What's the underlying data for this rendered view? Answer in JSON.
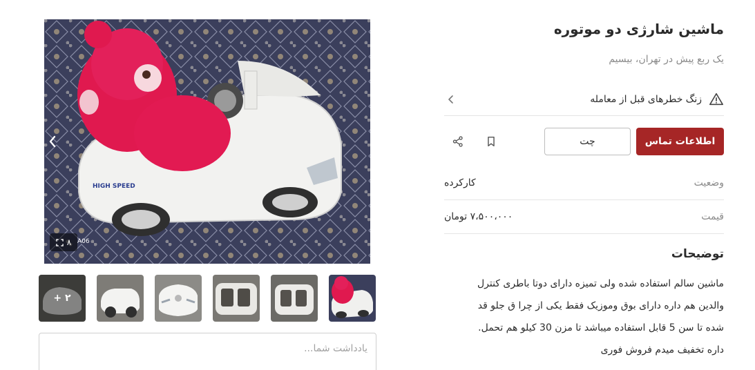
{
  "listing": {
    "title": "ماشین شارژی دو موتوره",
    "subtitle": "یک ربع پیش در تهران، بیسیم"
  },
  "warning": {
    "text": "زنگ خطرهای قبل از معامله",
    "icon": "warning-triangle-icon"
  },
  "actions": {
    "contact_label": "اطلاعات تماس",
    "chat_label": "چت",
    "bookmark_icon": "bookmark-icon",
    "share_icon": "share-icon"
  },
  "details": {
    "status_label": "وضعیت",
    "status_value": "کارکرده",
    "price_label": "قیمت",
    "price_value": "۷،۵۰۰،۰۰۰ تومان"
  },
  "description": {
    "title": "توضیحات",
    "lines": [
      "ماشین سالم استفاده شده ولی تمیزه دارای دوتا باطری کنترل",
      "والدین هم داره دارای بوق وموزیک فقط یکی از چرا ق جلو قد",
      "شده تا سن 5 قابل استفاده میباشد تا مزن 30 کیلو هم تحمل.",
      "داره تخفیف میدم فروش فوری"
    ]
  },
  "gallery": {
    "photo_count": "۸",
    "photo_text": "HIGH SPEED",
    "photo_tag": "A06",
    "more_label": "+ ۲",
    "thumbnails": [
      "photo-1",
      "photo-2",
      "photo-3",
      "photo-4",
      "photo-5",
      "photo-6"
    ]
  },
  "note": {
    "placeholder": "یادداشت شما..."
  },
  "colors": {
    "accent": "#a62626",
    "border": "#e4e4e4",
    "muted": "#8a8a8a"
  }
}
